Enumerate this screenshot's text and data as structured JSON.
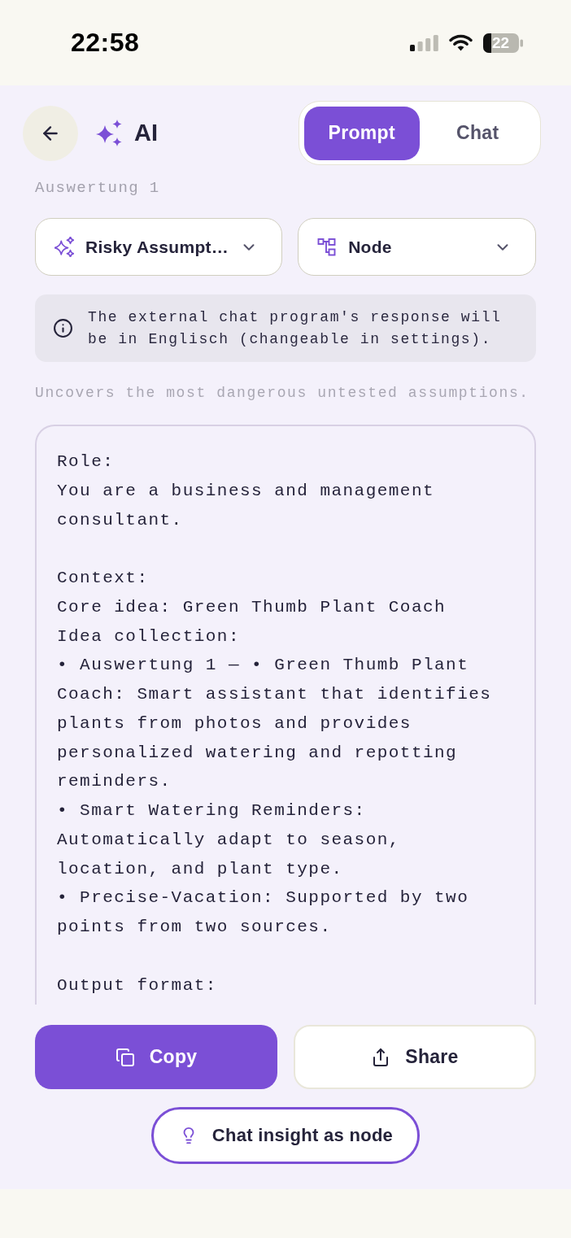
{
  "status_bar": {
    "time": "22:58",
    "battery": "22"
  },
  "header": {
    "title": "AI",
    "tabs": [
      {
        "label": "Prompt",
        "selected": true
      },
      {
        "label": "Chat",
        "selected": false
      }
    ]
  },
  "subtitle": "Auswertung 1",
  "selectors": [
    {
      "kind": "template",
      "label": "Risky Assumpt…"
    },
    {
      "kind": "target",
      "label": "Node"
    }
  ],
  "notice": {
    "text": "The external chat program's response will be in Englisch (changeable in settings)."
  },
  "description": "Uncovers the most dangerous untested assumptions.",
  "prompt": {
    "text": "Role:\nYou are a business and management consultant.\n\nContext:\nCore idea: Green Thumb Plant Coach\nIdea collection:\n• Auswertung 1 — • Green Thumb Plant Coach: Smart assistant that identifies plants from photos and provides personalized watering and repotting reminders.\n• Smart Watering Reminders: Automatically adapt to season, location, and plant type.\n• Precise-Vacation: Supported by two points from two sources.\n\nOutput format:"
  },
  "actions": [
    {
      "kind": "copy",
      "label": "Copy"
    },
    {
      "kind": "share",
      "label": "Share"
    }
  ],
  "insight_button": {
    "label": "Chat insight as node"
  }
}
